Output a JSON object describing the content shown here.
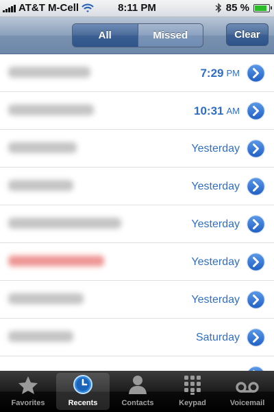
{
  "status_bar": {
    "carrier": "AT&T M-Cell",
    "time": "8:11 PM",
    "battery_level": "85 %",
    "battery_fraction": 0.85
  },
  "nav": {
    "segments": {
      "all": "All",
      "missed": "Missed"
    },
    "selected_segment": "all",
    "clear": "Clear"
  },
  "calls": [
    {
      "name_obscured": true,
      "missed": false,
      "time": "7:29",
      "ampm": "PM"
    },
    {
      "name_obscured": true,
      "missed": false,
      "time": "10:31",
      "ampm": "AM"
    },
    {
      "name_obscured": true,
      "missed": false,
      "day": "Yesterday"
    },
    {
      "name_obscured": true,
      "missed": false,
      "day": "Yesterday"
    },
    {
      "name_obscured": true,
      "missed": false,
      "day": "Yesterday"
    },
    {
      "name_obscured": true,
      "missed": true,
      "day": "Yesterday"
    },
    {
      "name_obscured": true,
      "missed": false,
      "day": "Yesterday"
    },
    {
      "name_obscured": true,
      "missed": false,
      "day": "Saturday"
    }
  ],
  "tabs": [
    {
      "label": "Favorites",
      "icon": "star-icon",
      "selected": false
    },
    {
      "label": "Recents",
      "icon": "clock-icon",
      "selected": true
    },
    {
      "label": "Contacts",
      "icon": "person-icon",
      "selected": false
    },
    {
      "label": "Keypad",
      "icon": "keypad-icon",
      "selected": false
    },
    {
      "label": "Voicemail",
      "icon": "voicemail-icon",
      "selected": false
    }
  ],
  "colors": {
    "accent_blue": "#2f6ec5",
    "missed_red": "#e0413e",
    "battery_green": "#2bbd29"
  }
}
